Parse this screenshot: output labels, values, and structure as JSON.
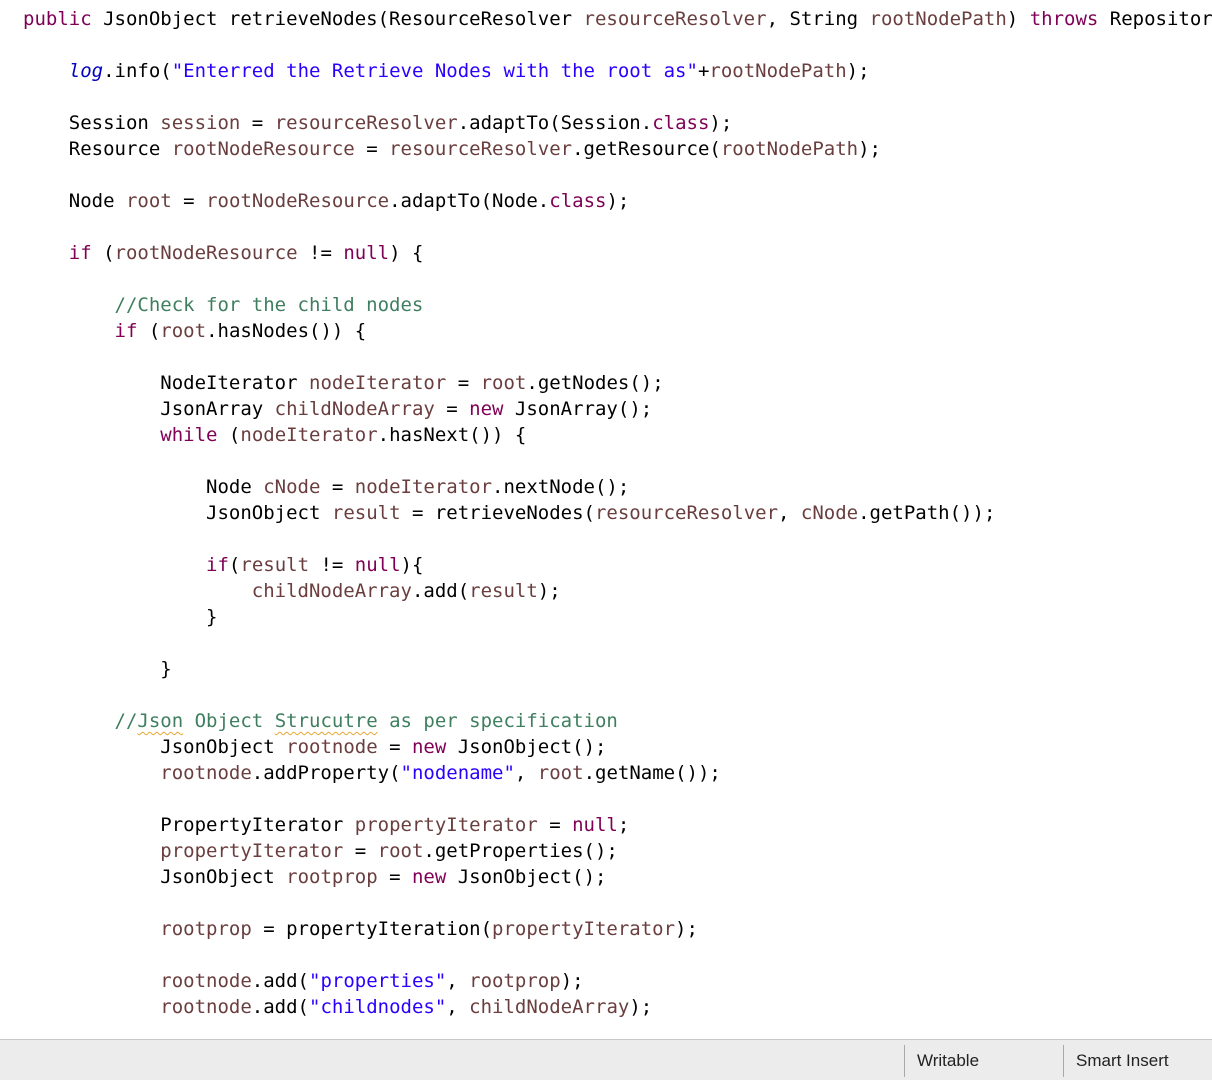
{
  "editor": {
    "lines": [
      {
        "indent": "",
        "tokens": [
          {
            "t": "kw",
            "v": "public"
          },
          {
            "t": "plain",
            "v": " JsonObject retrieveNodes(ResourceResolver "
          },
          {
            "t": "var",
            "v": "resourceResolver"
          },
          {
            "t": "plain",
            "v": ", String "
          },
          {
            "t": "var",
            "v": "rootNodePath"
          },
          {
            "t": "plain",
            "v": ") "
          },
          {
            "t": "kw",
            "v": "throws"
          },
          {
            "t": "plain",
            "v": " RepositoryException {"
          }
        ]
      },
      {
        "indent": "    ",
        "tokens": [
          {
            "t": "st",
            "v": "log"
          },
          {
            "t": "plain",
            "v": ".info("
          },
          {
            "t": "str",
            "v": "\"Enterred the Retrieve Nodes with the root as\""
          },
          {
            "t": "plain",
            "v": "+"
          },
          {
            "t": "var",
            "v": "rootNodePath"
          },
          {
            "t": "plain",
            "v": ");"
          }
        ]
      },
      {
        "indent": "    ",
        "tokens": [
          {
            "t": "plain",
            "v": "Session "
          },
          {
            "t": "var",
            "v": "session"
          },
          {
            "t": "plain",
            "v": " = "
          },
          {
            "t": "var",
            "v": "resourceResolver"
          },
          {
            "t": "plain",
            "v": ".adaptTo(Session."
          },
          {
            "t": "kw",
            "v": "class"
          },
          {
            "t": "plain",
            "v": ");"
          }
        ]
      },
      {
        "indent": "    ",
        "tokens": [
          {
            "t": "plain",
            "v": "Resource "
          },
          {
            "t": "var",
            "v": "rootNodeResource"
          },
          {
            "t": "plain",
            "v": " = "
          },
          {
            "t": "var",
            "v": "resourceResolver"
          },
          {
            "t": "plain",
            "v": ".getResource("
          },
          {
            "t": "var",
            "v": "rootNodePath"
          },
          {
            "t": "plain",
            "v": ");"
          }
        ]
      },
      {
        "indent": "    ",
        "tokens": [
          {
            "t": "plain",
            "v": "Node "
          },
          {
            "t": "var",
            "v": "root"
          },
          {
            "t": "plain",
            "v": " = "
          },
          {
            "t": "var",
            "v": "rootNodeResource"
          },
          {
            "t": "plain",
            "v": ".adaptTo(Node."
          },
          {
            "t": "kw",
            "v": "class"
          },
          {
            "t": "plain",
            "v": ");"
          }
        ]
      },
      {
        "indent": "    ",
        "tokens": [
          {
            "t": "kw",
            "v": "if"
          },
          {
            "t": "plain",
            "v": " ("
          },
          {
            "t": "var",
            "v": "rootNodeResource"
          },
          {
            "t": "plain",
            "v": " != "
          },
          {
            "t": "kw",
            "v": "null"
          },
          {
            "t": "plain",
            "v": ") {"
          }
        ]
      },
      {
        "indent": "        ",
        "tokens": [
          {
            "t": "cm",
            "v": "//Check for the child nodes"
          }
        ]
      },
      {
        "indent": "        ",
        "tokens": [
          {
            "t": "kw",
            "v": "if"
          },
          {
            "t": "plain",
            "v": " ("
          },
          {
            "t": "var",
            "v": "root"
          },
          {
            "t": "plain",
            "v": ".hasNodes()) {"
          }
        ]
      },
      {
        "indent": "            ",
        "tokens": [
          {
            "t": "plain",
            "v": "NodeIterator "
          },
          {
            "t": "var",
            "v": "nodeIterator"
          },
          {
            "t": "plain",
            "v": " = "
          },
          {
            "t": "var",
            "v": "root"
          },
          {
            "t": "plain",
            "v": ".getNodes();"
          }
        ]
      },
      {
        "indent": "            ",
        "tokens": [
          {
            "t": "plain",
            "v": "JsonArray "
          },
          {
            "t": "var",
            "v": "childNodeArray"
          },
          {
            "t": "plain",
            "v": " = "
          },
          {
            "t": "kw",
            "v": "new"
          },
          {
            "t": "plain",
            "v": " JsonArray();"
          }
        ]
      },
      {
        "indent": "            ",
        "tokens": [
          {
            "t": "kw",
            "v": "while"
          },
          {
            "t": "plain",
            "v": " ("
          },
          {
            "t": "var",
            "v": "nodeIterator"
          },
          {
            "t": "plain",
            "v": ".hasNext()) {"
          }
        ]
      },
      {
        "indent": "                ",
        "tokens": [
          {
            "t": "plain",
            "v": "Node "
          },
          {
            "t": "var",
            "v": "cNode"
          },
          {
            "t": "plain",
            "v": " = "
          },
          {
            "t": "var",
            "v": "nodeIterator"
          },
          {
            "t": "plain",
            "v": ".nextNode();"
          }
        ]
      },
      {
        "indent": "                ",
        "tokens": [
          {
            "t": "plain",
            "v": "JsonObject "
          },
          {
            "t": "var",
            "v": "result"
          },
          {
            "t": "plain",
            "v": " = retrieveNodes("
          },
          {
            "t": "var",
            "v": "resourceResolver"
          },
          {
            "t": "plain",
            "v": ", "
          },
          {
            "t": "var",
            "v": "cNode"
          },
          {
            "t": "plain",
            "v": ".getPath());"
          }
        ]
      },
      {
        "indent": "                ",
        "tokens": [
          {
            "t": "kw",
            "v": "if"
          },
          {
            "t": "plain",
            "v": "("
          },
          {
            "t": "var",
            "v": "result"
          },
          {
            "t": "plain",
            "v": " != "
          },
          {
            "t": "kw",
            "v": "null"
          },
          {
            "t": "plain",
            "v": "){"
          }
        ]
      },
      {
        "indent": "                    ",
        "tokens": [
          {
            "t": "var",
            "v": "childNodeArray"
          },
          {
            "t": "plain",
            "v": ".add("
          },
          {
            "t": "var",
            "v": "result"
          },
          {
            "t": "plain",
            "v": ");"
          }
        ]
      },
      {
        "indent": "                ",
        "tokens": [
          {
            "t": "plain",
            "v": "}"
          }
        ]
      },
      {
        "indent": "            ",
        "tokens": [
          {
            "t": "plain",
            "v": "}"
          }
        ]
      },
      {
        "indent": "        ",
        "tokens": [
          {
            "t": "cm",
            "v": "//"
          },
          {
            "t": "cm sp",
            "v": "Json"
          },
          {
            "t": "cm",
            "v": " Object "
          },
          {
            "t": "cm sp",
            "v": "Strucutre"
          },
          {
            "t": "cm",
            "v": " as per specification"
          }
        ]
      },
      {
        "indent": "            ",
        "tokens": [
          {
            "t": "plain",
            "v": "JsonObject "
          },
          {
            "t": "var",
            "v": "rootnode"
          },
          {
            "t": "plain",
            "v": " = "
          },
          {
            "t": "kw",
            "v": "new"
          },
          {
            "t": "plain",
            "v": " JsonObject();"
          }
        ]
      },
      {
        "indent": "            ",
        "tokens": [
          {
            "t": "var",
            "v": "rootnode"
          },
          {
            "t": "plain",
            "v": ".addProperty("
          },
          {
            "t": "str",
            "v": "\"nodename\""
          },
          {
            "t": "plain",
            "v": ", "
          },
          {
            "t": "var",
            "v": "root"
          },
          {
            "t": "plain",
            "v": ".getName());"
          }
        ]
      },
      {
        "indent": "            ",
        "tokens": [
          {
            "t": "plain",
            "v": "PropertyIterator "
          },
          {
            "t": "var",
            "v": "propertyIterator"
          },
          {
            "t": "plain",
            "v": " = "
          },
          {
            "t": "kw",
            "v": "null"
          },
          {
            "t": "plain",
            "v": ";"
          }
        ]
      },
      {
        "indent": "            ",
        "tokens": [
          {
            "t": "var",
            "v": "propertyIterator"
          },
          {
            "t": "plain",
            "v": " = "
          },
          {
            "t": "var",
            "v": "root"
          },
          {
            "t": "plain",
            "v": ".getProperties();"
          }
        ]
      },
      {
        "indent": "            ",
        "tokens": [
          {
            "t": "plain",
            "v": "JsonObject "
          },
          {
            "t": "var",
            "v": "rootprop"
          },
          {
            "t": "plain",
            "v": " = "
          },
          {
            "t": "kw",
            "v": "new"
          },
          {
            "t": "plain",
            "v": " JsonObject();"
          }
        ]
      },
      {
        "indent": "            ",
        "tokens": [
          {
            "t": "var",
            "v": "rootprop"
          },
          {
            "t": "plain",
            "v": " = propertyIteration("
          },
          {
            "t": "var",
            "v": "propertyIterator"
          },
          {
            "t": "plain",
            "v": ");"
          }
        ]
      },
      {
        "indent": "            ",
        "tokens": [
          {
            "t": "var",
            "v": "rootnode"
          },
          {
            "t": "plain",
            "v": ".add("
          },
          {
            "t": "str",
            "v": "\"properties\""
          },
          {
            "t": "plain",
            "v": ", "
          },
          {
            "t": "var",
            "v": "rootprop"
          },
          {
            "t": "plain",
            "v": ");"
          }
        ]
      },
      {
        "indent": "            ",
        "tokens": [
          {
            "t": "var",
            "v": "rootnode"
          },
          {
            "t": "plain",
            "v": ".add("
          },
          {
            "t": "str",
            "v": "\"childnodes\""
          },
          {
            "t": "plain",
            "v": ", "
          },
          {
            "t": "var",
            "v": "childNodeArray"
          },
          {
            "t": "plain",
            "v": ");"
          }
        ]
      }
    ]
  },
  "status_bar": {
    "mode": "Writable",
    "insert_mode": "Smart Insert"
  },
  "colors": {
    "keyword": "#7f0055",
    "local_variable": "#6a3e3e",
    "string": "#2a00ff",
    "comment": "#3f7f5f",
    "static_field": "#0000c0",
    "spelling_squiggle": "#e8a735"
  }
}
